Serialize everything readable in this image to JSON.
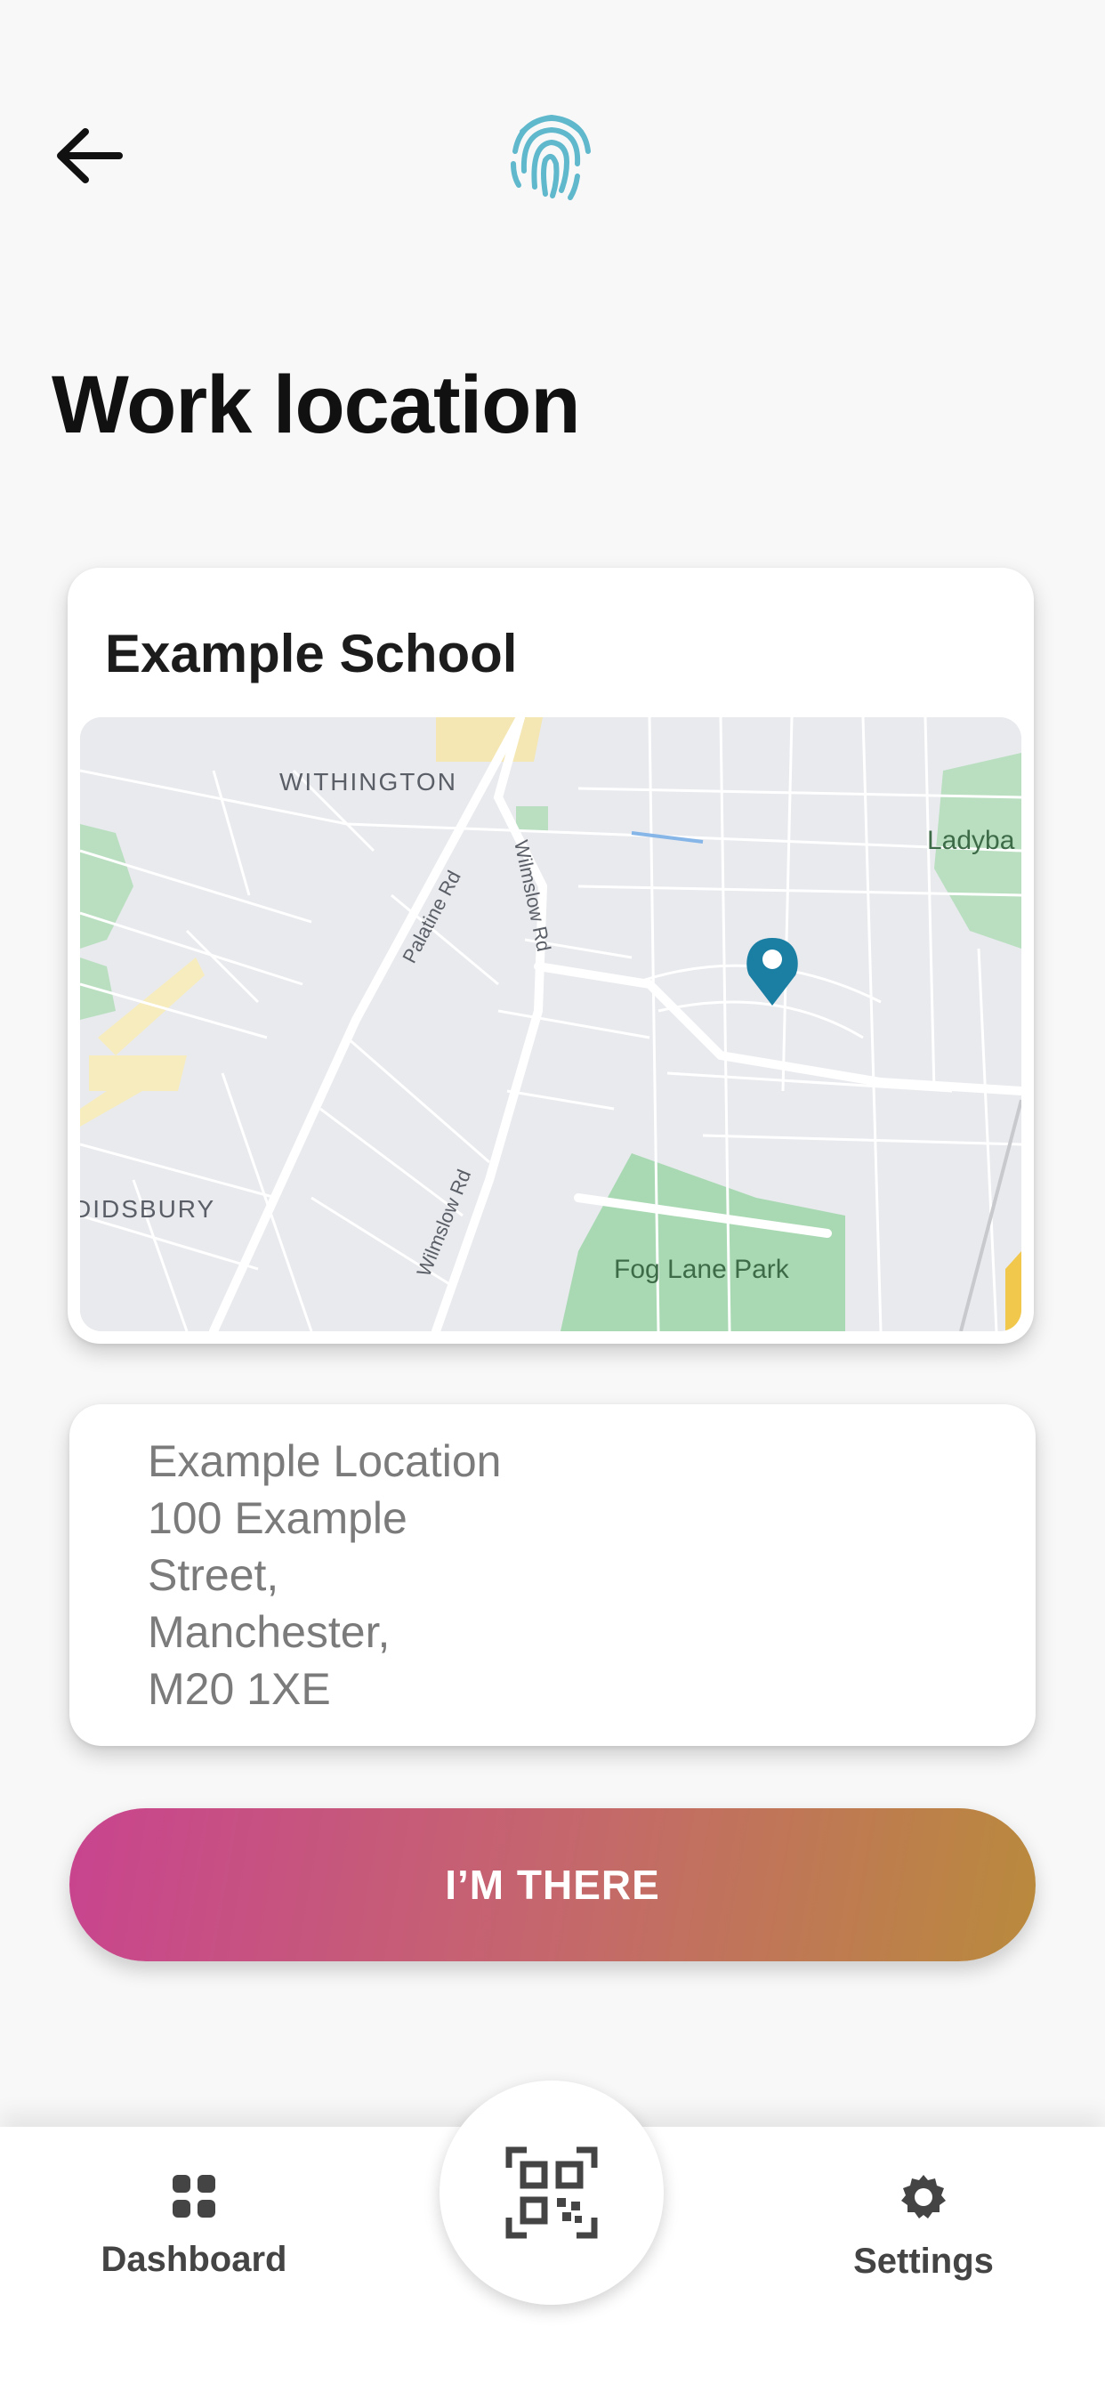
{
  "header": {
    "back_icon": "arrow-left-icon",
    "logo_icon": "fingerprint-icon",
    "logo_color": "#5fb8cc"
  },
  "page": {
    "title": "Work location"
  },
  "location_card": {
    "name": "Example School",
    "map": {
      "labels": {
        "withington": "WITHINGTON",
        "didsbury": "DIDSBURY",
        "palatine": "Palatine Rd",
        "wilmslow_top": "Wilmslow Rd",
        "wilmslow_bottom": "Wilmslow Rd",
        "park": "Fog Lane Park",
        "ladybarn": "Ladyba"
      },
      "pin_icon": "map-pin-icon",
      "pin_color": "#1a7fa3"
    }
  },
  "address": {
    "lines": [
      "Example Location",
      "100 Example",
      "Street,",
      "Manchester,",
      "M20 1XE"
    ]
  },
  "action": {
    "label": "I’M THERE"
  },
  "tabbar": {
    "dashboard_label": "Dashboard",
    "settings_label": "Settings",
    "scan_icon": "qr-scan-icon"
  }
}
